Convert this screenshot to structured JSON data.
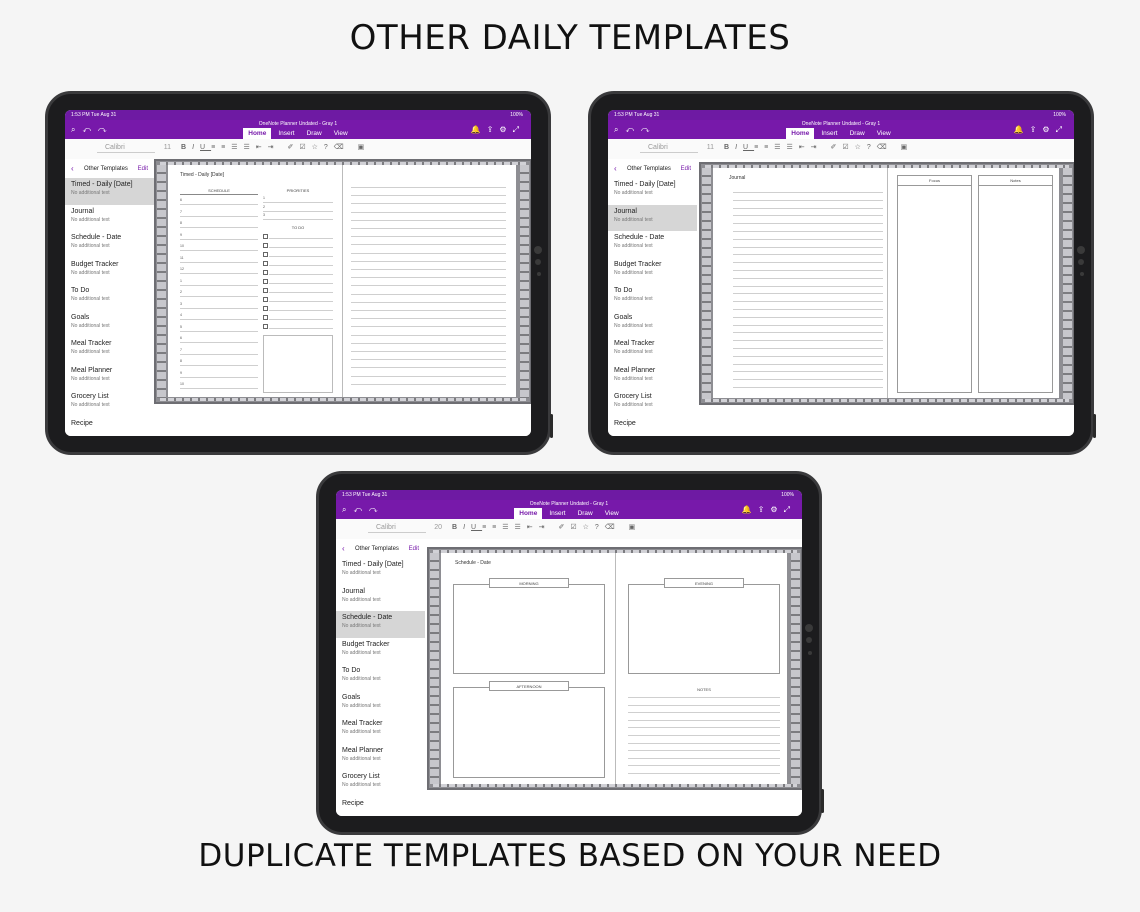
{
  "headline_top": "OTHER DAILY TEMPLATES",
  "headline_bottom": "DUPLICATE TEMPLATES BASED ON YOUR NEED",
  "status": {
    "time": "1:53 PM   Tue Aug 31",
    "battery": "100%"
  },
  "app": {
    "doc_title": "OneNote Planner Undated - Gray 1",
    "tabs": [
      "Home",
      "Insert",
      "Draw",
      "View"
    ],
    "font_name": "Calibri",
    "font_size_1": "11",
    "font_size_3": "20",
    "styles_label": "Styles"
  },
  "sidebar": {
    "section": "Other Templates",
    "edit": "Edit",
    "sub_text": "No additional text",
    "items": [
      "Timed - Daily [Date]",
      "Journal",
      "Schedule - Date",
      "Budget Tracker",
      "To Do",
      "Goals",
      "Meal Tracker",
      "Meal Planner",
      "Grocery List",
      "Recipe"
    ]
  },
  "page1": {
    "title": "Timed - Daily [Date]",
    "schedule": "SCHEDULE",
    "priorities": "PRIORITIES",
    "todo": "TO DO",
    "hours": [
      "6",
      "7",
      "8",
      "9",
      "10",
      "11",
      "12",
      "1",
      "2",
      "3",
      "4",
      "5",
      "6",
      "7",
      "8",
      "9",
      "10"
    ],
    "priority_nums": [
      "1",
      "2",
      "3"
    ]
  },
  "page2": {
    "title": "Journal",
    "focus": "Focus",
    "notes": "Notes"
  },
  "page3": {
    "title": "Schedule - Date",
    "morning": "MORNING",
    "evening": "EVENING",
    "afternoon": "AFTERNOON",
    "notes": "NOTES"
  }
}
